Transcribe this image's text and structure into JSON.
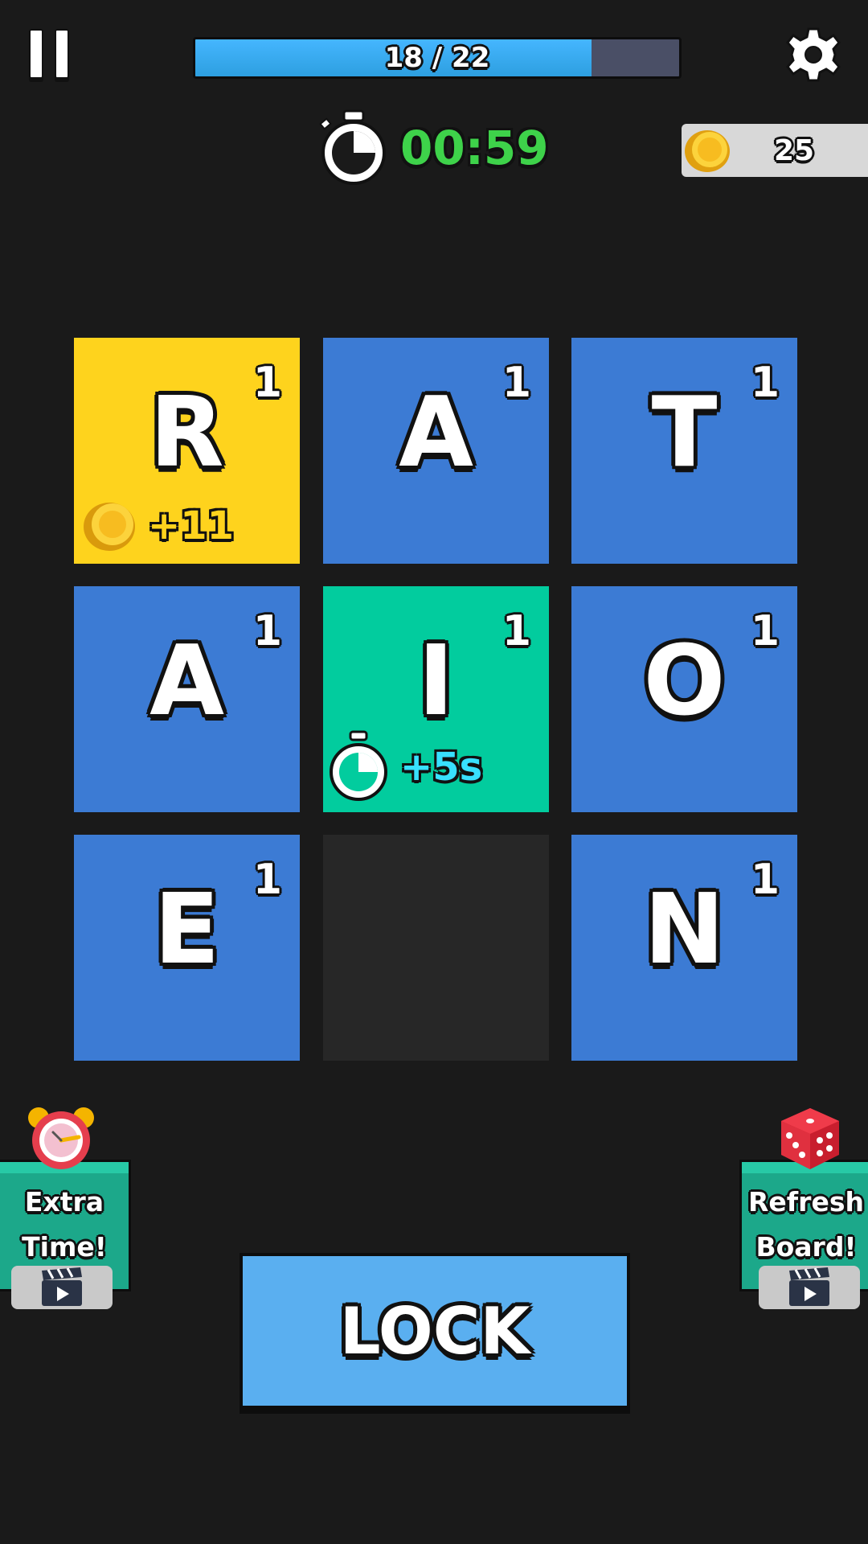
{
  "header": {
    "progress": {
      "label": "18 / 22",
      "current": 18,
      "total": 22
    },
    "pause_icon": "pause-icon",
    "settings_icon": "gear-icon"
  },
  "timer": {
    "value": "00:59",
    "icon": "stopwatch-icon",
    "color": "#3ed24a"
  },
  "coins": {
    "value": "25",
    "icon": "coin-icon"
  },
  "board": {
    "tiles": [
      {
        "letter": "R",
        "points": "1",
        "color": "#fed31d",
        "bonus": "+11",
        "bonus_type": "coin"
      },
      {
        "letter": "A",
        "points": "1",
        "color": "#3c7bd4"
      },
      {
        "letter": "T",
        "points": "1",
        "color": "#3c7bd4"
      },
      {
        "letter": "A",
        "points": "1",
        "color": "#3c7bd4"
      },
      {
        "letter": "I",
        "points": "1",
        "color": "#02cc9e",
        "bonus": "+5s",
        "bonus_type": "time"
      },
      {
        "letter": "O",
        "points": "1",
        "color": "#3c7bd4"
      },
      {
        "letter": "E",
        "points": "1",
        "color": "#3c7bd4"
      },
      {
        "letter": "",
        "points": "",
        "color": "#272727"
      },
      {
        "letter": "N",
        "points": "1",
        "color": "#3c7bd4"
      }
    ]
  },
  "powerups": {
    "extra_time": {
      "line1": "Extra",
      "line2": "Time!",
      "icon": "alarm-clock-icon",
      "ad_icon": "clapperboard-icon"
    },
    "refresh_board": {
      "line1": "Refresh",
      "line2": "Board!",
      "icon": "dice-icon",
      "ad_icon": "clapperboard-icon"
    }
  },
  "lock_button": {
    "label": "LOCK"
  },
  "colors": {
    "background": "#1a1a1a",
    "tile_blue": "#3c7bd4",
    "tile_yellow": "#fed31d",
    "tile_teal": "#02cc9e",
    "lock_button": "#5aaff0"
  }
}
